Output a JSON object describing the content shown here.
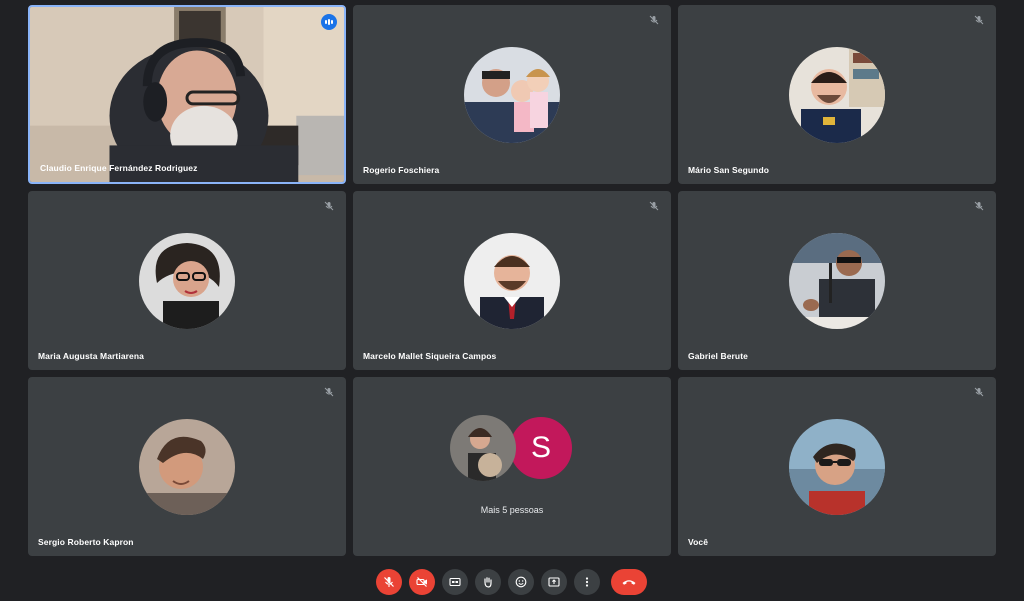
{
  "participants": [
    {
      "name": "Claudio Enrique Fernández Rodriguez",
      "muted": false,
      "speaking": true
    },
    {
      "name": "Rogerio Foschiera",
      "muted": true
    },
    {
      "name": "Mário San Segundo",
      "muted": true
    },
    {
      "name": "Maria Augusta Martiarena",
      "muted": true
    },
    {
      "name": "Marcelo Mallet Siqueira Campos",
      "muted": true
    },
    {
      "name": "Gabriel Berute",
      "muted": true
    },
    {
      "name": "Sergio Roberto Kapron",
      "muted": true
    },
    {
      "name": "Você",
      "muted": true
    }
  ],
  "overflow": {
    "label": "Mais 5 pessoas",
    "initial": "S",
    "initial_color": "#c2185b"
  },
  "toolbar": {
    "buttons": [
      "microphone-off",
      "camera-off",
      "captions",
      "raise-hand",
      "reactions",
      "present-screen",
      "more-options",
      "leave-call"
    ]
  },
  "colors": {
    "background": "#202124",
    "tile": "#3c4043",
    "accent": "#1a73e8",
    "danger": "#ea4335",
    "active_border": "#8ab4f8"
  }
}
